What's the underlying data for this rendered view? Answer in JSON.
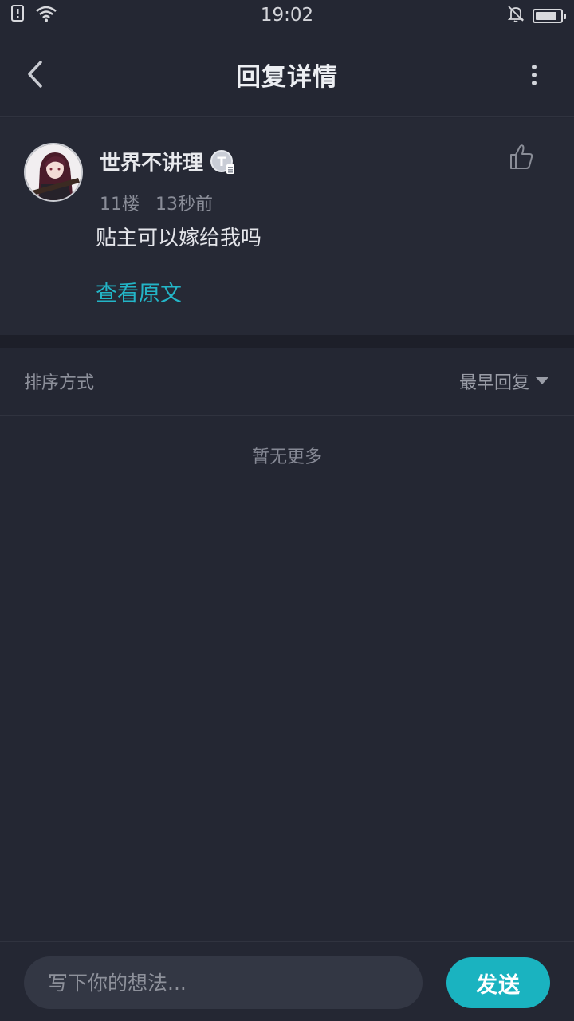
{
  "status_bar": {
    "time": "19:02"
  },
  "header": {
    "title": "回复详情"
  },
  "comment": {
    "username": "世界不讲理",
    "level_badge": "T",
    "floor": "11楼",
    "time_ago": "13秒前",
    "text": "贴主可以嫁给我吗",
    "view_original": "查看原文"
  },
  "sort": {
    "label": "排序方式",
    "selected": "最早回复"
  },
  "list": {
    "empty_text": "暂无更多"
  },
  "input": {
    "placeholder": "写下你的想法...",
    "send_label": "发送"
  },
  "colors": {
    "accent": "#1ab3c0",
    "link": "#23b5c7",
    "background": "#242733"
  }
}
